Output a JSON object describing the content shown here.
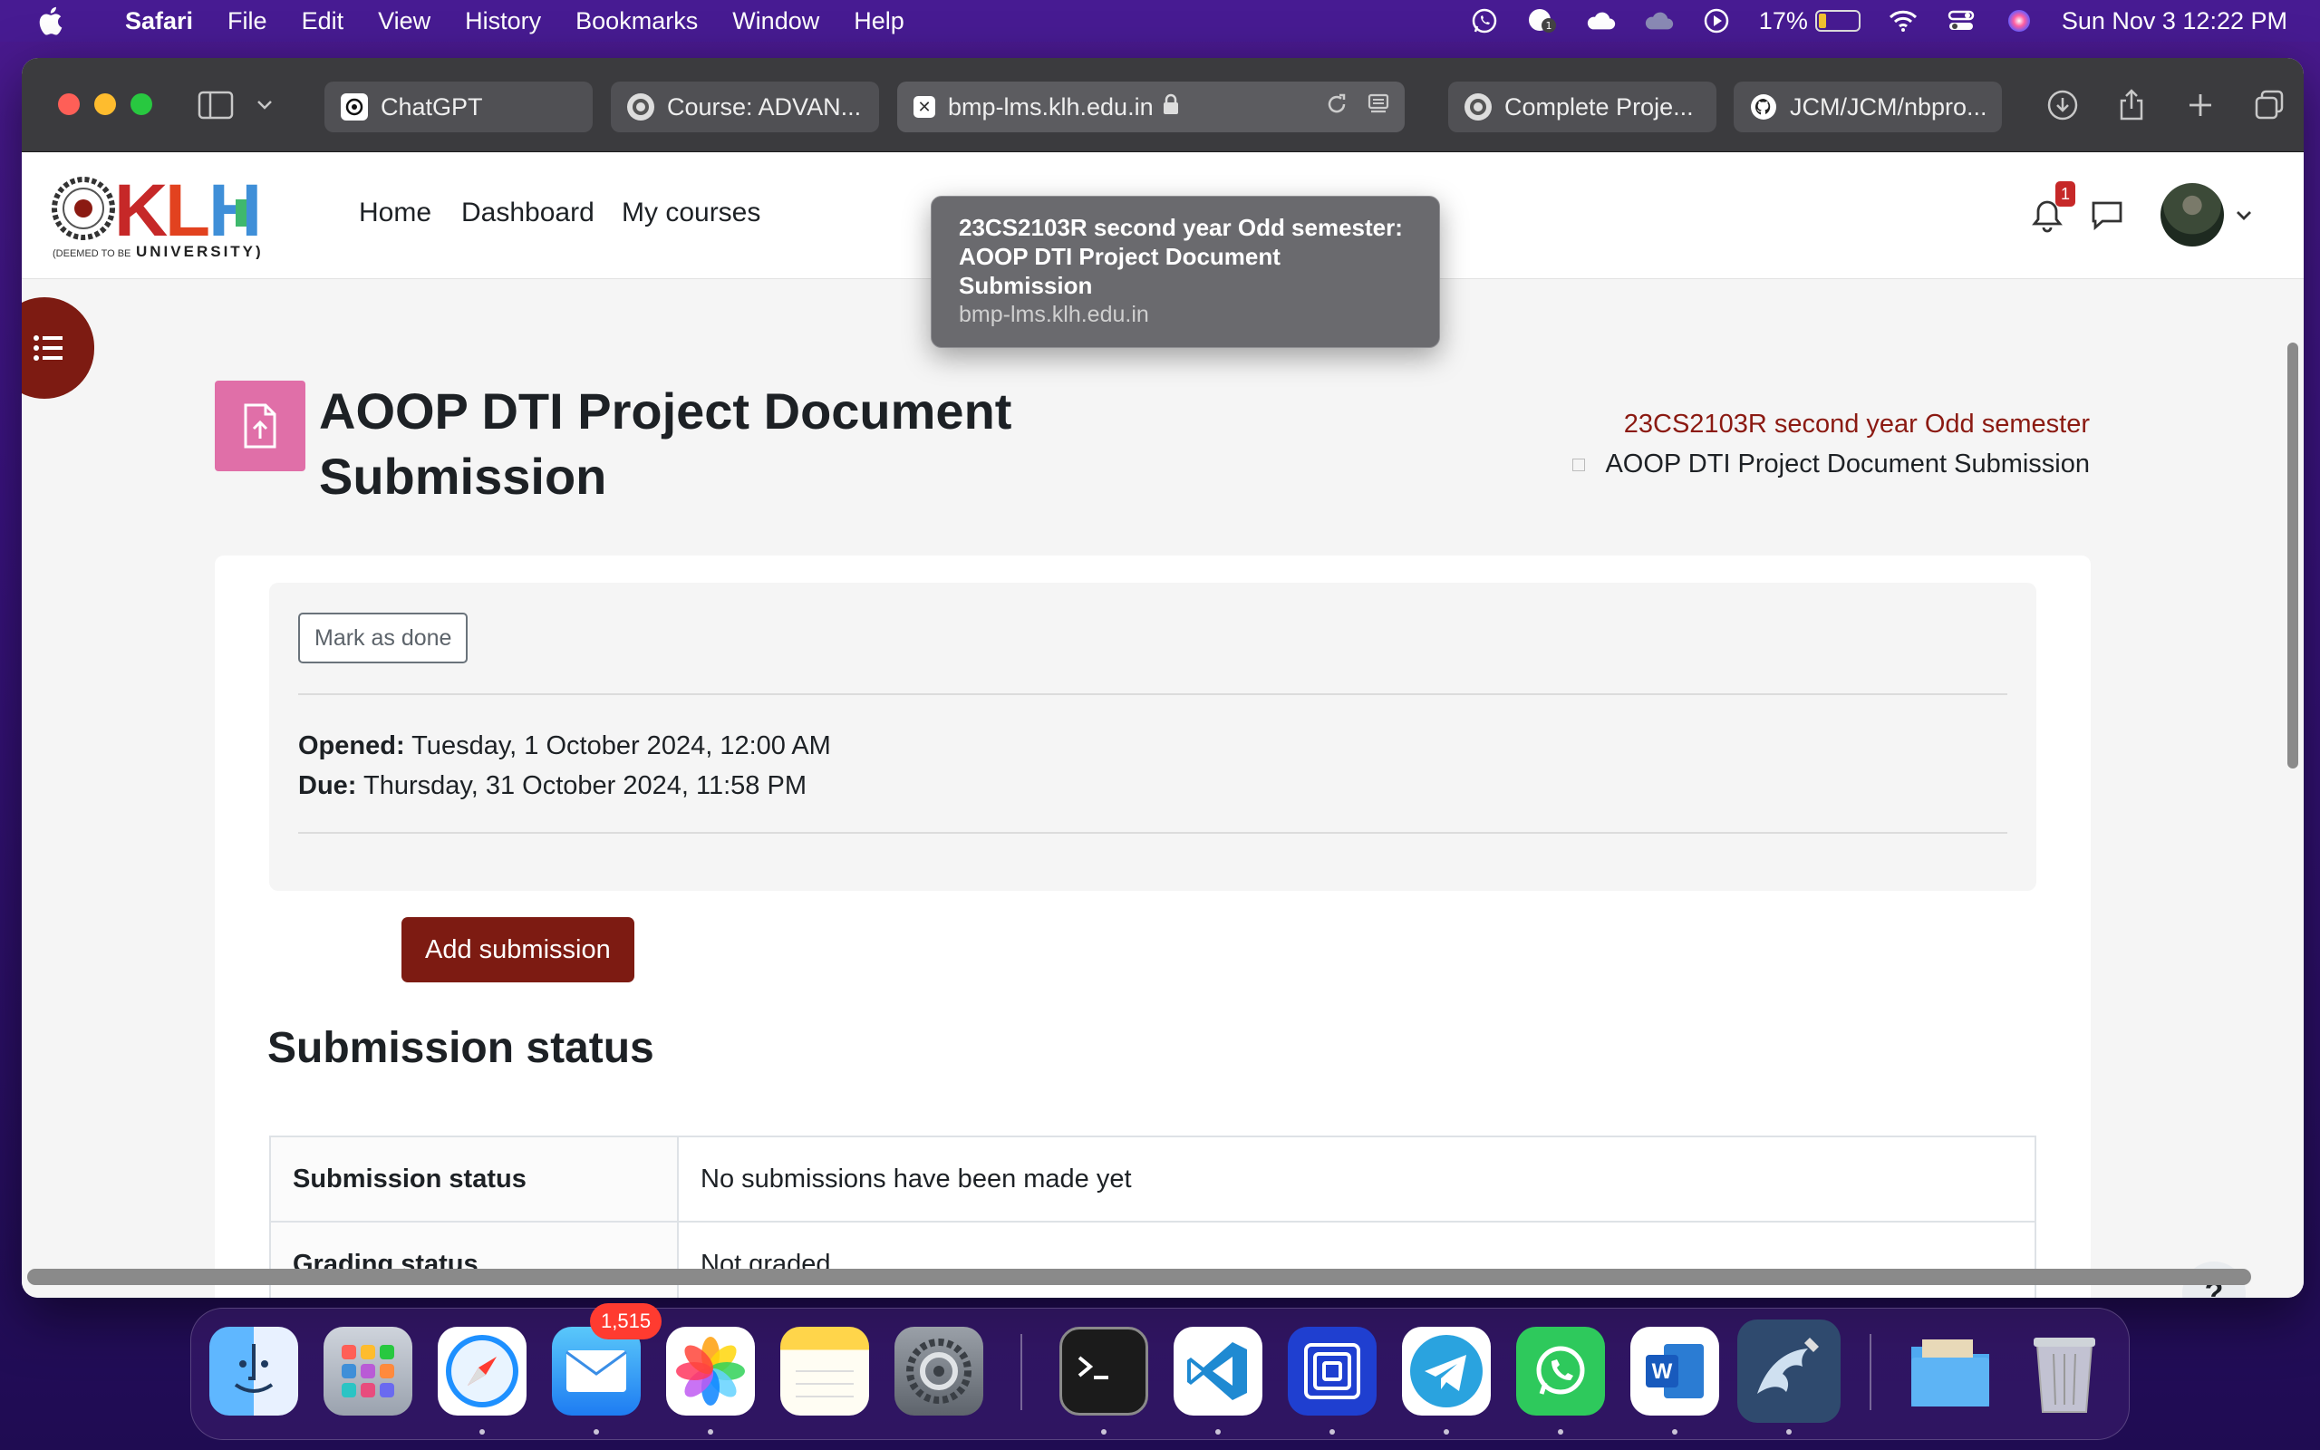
{
  "menubar": {
    "app": "Safari",
    "items": [
      "File",
      "Edit",
      "View",
      "History",
      "Bookmarks",
      "Window",
      "Help"
    ],
    "battery_percent": "17%",
    "datetime": "Sun Nov 3  12:22 PM"
  },
  "browser": {
    "tabs": [
      {
        "label": "ChatGPT"
      },
      {
        "label": "Course: ADVAN..."
      },
      {
        "label": "bmp-lms.klh.edu.in"
      },
      {
        "label": "Complete Proje..."
      },
      {
        "label": "JCM/JCM/nbpro..."
      }
    ],
    "tooltip": {
      "title": "23CS2103R second year Odd semester: AOOP DTI Project Document Submission",
      "url": "bmp-lms.klh.edu.in"
    }
  },
  "site": {
    "logo_text": "KLH",
    "logo_subtext": "UNIVERSITY",
    "logo_small": "(DEEMED TO BE",
    "nav": {
      "home": "Home",
      "dashboard": "Dashboard",
      "my_courses": "My courses"
    },
    "notification_count": "1"
  },
  "page": {
    "title": "AOOP DTI Project Document Submission",
    "breadcrumb": {
      "course": "23CS2103R second year Odd semester",
      "current": "AOOP DTI Project Document Submission"
    },
    "mark_done_label": "Mark as done",
    "opened_label": "Opened:",
    "opened_value": "Tuesday, 1 October 2024, 12:00 AM",
    "due_label": "Due:",
    "due_value": "Thursday, 31 October 2024, 11:58 PM",
    "add_submission_label": "Add submission",
    "section_title": "Submission status",
    "status_rows": [
      {
        "label": "Submission status",
        "value": "No submissions have been made yet"
      },
      {
        "label": "Grading status",
        "value": "Not graded"
      }
    ],
    "help_label": "?"
  },
  "dock": {
    "mail_badge": "1,515"
  },
  "colors": {
    "brand": "#7d1b12",
    "activity_icon": "#e06fa8",
    "breadcrumb_link": "#8b1a12"
  }
}
